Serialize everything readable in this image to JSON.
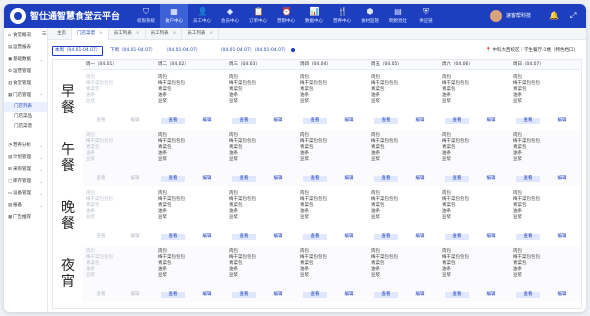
{
  "app": {
    "title": "智仕通智慧食堂云平台",
    "user_name": "速客帮科技"
  },
  "nav": [
    {
      "label": "权限系统",
      "icon": "shield"
    },
    {
      "label": "食户中心",
      "icon": "building"
    },
    {
      "label": "员工中心",
      "icon": "person"
    },
    {
      "label": "会员中心",
      "icon": "diamond"
    },
    {
      "label": "订单中心",
      "icon": "clipboard"
    },
    {
      "label": "营销中心",
      "icon": "alarm"
    },
    {
      "label": "数据中心",
      "icon": "chart"
    },
    {
      "label": "营养中心",
      "icon": "fork"
    },
    {
      "label": "食材监管",
      "icon": "badge"
    },
    {
      "label": "明厨亮灶",
      "icon": "stove"
    },
    {
      "label": "供应链",
      "icon": "shield-check"
    }
  ],
  "sidebar": {
    "items": [
      {
        "label": "食堂概况",
        "icon": "home",
        "arrow": ""
      },
      {
        "label": "运营报表",
        "icon": "doc",
        "arrow": ""
      },
      {
        "label": "基础数据",
        "icon": "db",
        "arrow": "⌄"
      },
      {
        "label": "运营管理",
        "icon": "gear",
        "arrow": ""
      },
      {
        "label": "食堂管理",
        "icon": "store",
        "arrow": ""
      },
      {
        "label": "门店管理",
        "icon": "shop",
        "arrow": "⌃"
      }
    ],
    "subs": [
      {
        "label": "门店列表"
      },
      {
        "label": "门店菜品"
      },
      {
        "label": "门店菜谱"
      }
    ],
    "items2": [
      {
        "label": "营养分析",
        "icon": "chart",
        "arrow": "⌄"
      },
      {
        "label": "计划管理",
        "icon": "cal",
        "arrow": "⌄"
      },
      {
        "label": "采购管理",
        "icon": "cart",
        "arrow": "⌄"
      },
      {
        "label": "库存管理",
        "icon": "box",
        "arrow": "⌄"
      },
      {
        "label": "设备管理",
        "icon": "device",
        "arrow": "⌄"
      },
      {
        "label": "报备",
        "icon": "report",
        "arrow": "⌄"
      },
      {
        "label": "广告推荐",
        "icon": "ad",
        "arrow": ""
      }
    ]
  },
  "tabs": [
    {
      "label": "主页",
      "active": false
    },
    {
      "label": "门店菜谱",
      "active": true
    },
    {
      "label": "员工列表",
      "active": false
    },
    {
      "label": "员工列表",
      "active": false
    },
    {
      "label": "员工列表",
      "active": false
    }
  ],
  "weeks": {
    "w1": "本周（04.01-04.07）",
    "w2": "下周（04.01-04.07）",
    "w3": "（04.01-04.07）",
    "w4": "（04.01-04.07）",
    "w5": "（04.01-04.07）",
    "location": "中科大西校区｜学生餐厅-1楼（特色档口）"
  },
  "days": [
    "周一（04.01）",
    "周二（04.02）",
    "周三（04.03）",
    "周四（04.04）",
    "周五（04.05）",
    "周六（04.06）",
    "周日（04.07）"
  ],
  "meals": [
    "早餐",
    "午餐",
    "晚餐",
    "夜宵"
  ],
  "dishes": [
    "肉包",
    "梅干菜包包包",
    "青菜包",
    "油条",
    "豆浆"
  ],
  "buttons": {
    "view": "查看",
    "edit": "编辑"
  }
}
